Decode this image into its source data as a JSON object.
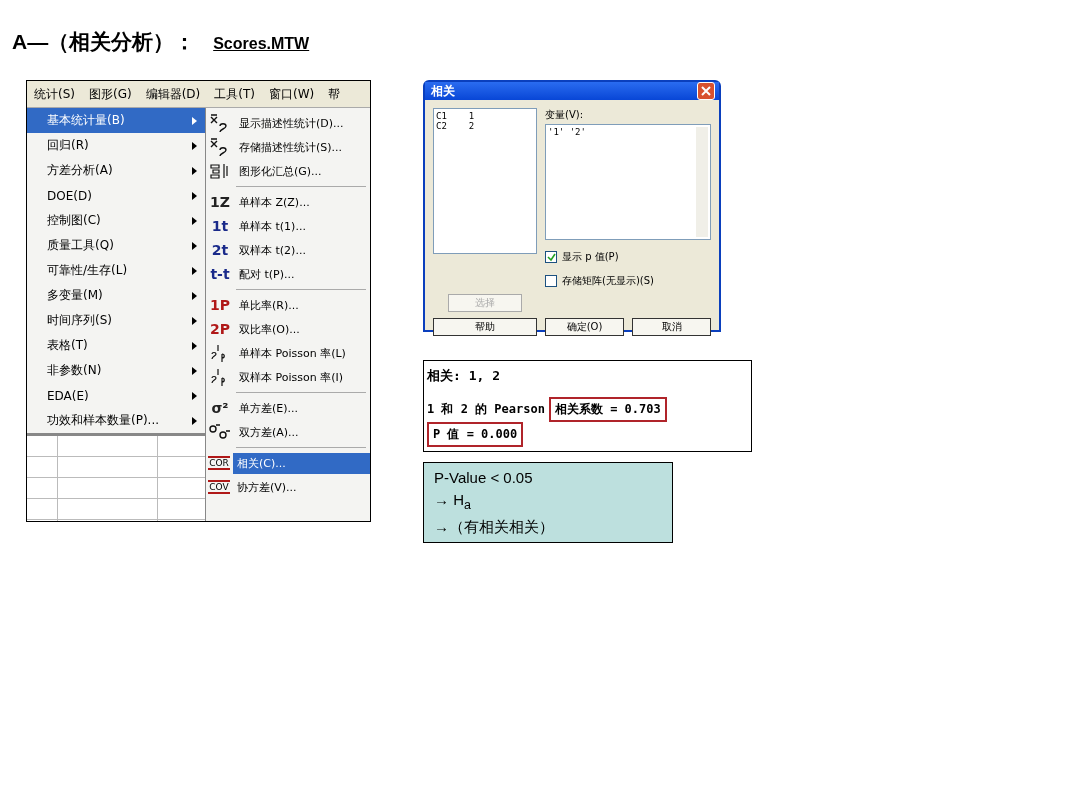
{
  "heading": {
    "title": "A—（相关分析）：",
    "file_link": "Scores.MTW"
  },
  "menu_screenshot": {
    "menubar": [
      {
        "label": "统计(S)",
        "selected": false
      },
      {
        "label": "图形(G)",
        "selected": false
      },
      {
        "label": "编辑器(D)",
        "selected": false
      },
      {
        "label": "工具(T)",
        "selected": false
      },
      {
        "label": "窗口(W)",
        "selected": false
      },
      {
        "label": "帮",
        "selected": false
      }
    ],
    "menu_items": [
      {
        "label": "基本统计量(B)",
        "selected": true
      },
      {
        "label": "回归(R)",
        "selected": false
      },
      {
        "label": "方差分析(A)",
        "selected": false
      },
      {
        "label": "DOE(D)",
        "selected": false
      },
      {
        "label": "控制图(C)",
        "selected": false
      },
      {
        "label": "质量工具(Q)",
        "selected": false
      },
      {
        "label": "可靠性/生存(L)",
        "selected": false
      },
      {
        "label": "多变量(M)",
        "selected": false
      },
      {
        "label": "时间序列(S)",
        "selected": false
      },
      {
        "label": "表格(T)",
        "selected": false
      },
      {
        "label": "非参数(N)",
        "selected": false
      },
      {
        "label": "EDA(E)",
        "selected": false
      },
      {
        "label": "功效和样本数量(P)...",
        "selected": false
      }
    ],
    "submenu_groups": [
      [
        {
          "kind": "symbol",
          "label": "显示描述性统计(D)...",
          "selected": false
        },
        {
          "kind": "symbol",
          "label": "存储描述性统计(S)...",
          "selected": false
        },
        {
          "kind": "chart",
          "label": "图形化汇总(G)...",
          "selected": false
        }
      ],
      [
        {
          "kind": "text",
          "icon_text": "1Z",
          "color": "#222222",
          "label": "单样本 Z(Z)...",
          "selected": false
        },
        {
          "kind": "text",
          "icon_text": "1t",
          "color": "#1a2a8a",
          "label": "单样本 t(1)...",
          "selected": false
        },
        {
          "kind": "text",
          "icon_text": "2t",
          "color": "#1a2a8a",
          "label": "双样本 t(2)...",
          "selected": false
        },
        {
          "kind": "text",
          "icon_text": "t-t",
          "color": "#1a2a8a",
          "label": "配对 t(P)...",
          "selected": false
        }
      ],
      [
        {
          "kind": "text",
          "icon_text": "1P",
          "color": "#b01818",
          "label": "单比率(R)...",
          "selected": false
        },
        {
          "kind": "text",
          "icon_text": "2P",
          "color": "#b01818",
          "label": "双比率(O)...",
          "selected": false
        },
        {
          "kind": "poisson",
          "label": "单样本 Poisson 率(L)",
          "selected": false
        },
        {
          "kind": "poisson",
          "label": "双样本 Poisson 率(I)",
          "selected": false
        }
      ],
      [
        {
          "kind": "text",
          "icon_text": "σ²",
          "color": "#222222",
          "label": "单方差(E)...",
          "selected": false
        },
        {
          "kind": "sigma2",
          "label": "双方差(A)...",
          "selected": false
        }
      ],
      [
        {
          "kind": "boxed",
          "icon_text": "COR",
          "label": "相关(C)...",
          "selected": true
        },
        {
          "kind": "boxed",
          "icon_text": "COV",
          "label": "协方差(V)...",
          "selected": false
        }
      ]
    ]
  },
  "dialog": {
    "title": "相关",
    "columns_list": [
      {
        "id": "C1",
        "name": "1"
      },
      {
        "id": "C2",
        "name": "2"
      }
    ],
    "variables_label": "变量(V):",
    "variables_value": "'1' '2'",
    "checkboxes": [
      {
        "label": "显示 p 值(P)",
        "checked": true
      },
      {
        "label": "存储矩阵(无显示)(S)",
        "checked": false
      }
    ],
    "select_button": {
      "label": "选择",
      "disabled": true
    },
    "buttons": [
      "帮助",
      "确定(O)",
      "取消"
    ]
  },
  "output": {
    "header": "相关: 1, 2",
    "pearson_prefix": "1 和 2 的 Pearson",
    "coefficient": "相关系数 = 0.703",
    "p_value": "P 值 = 0.000"
  },
  "note": {
    "lines": [
      "P-Value < 0.05",
      "→ H$_{a}$",
      "→（有相关相关）"
    ]
  }
}
